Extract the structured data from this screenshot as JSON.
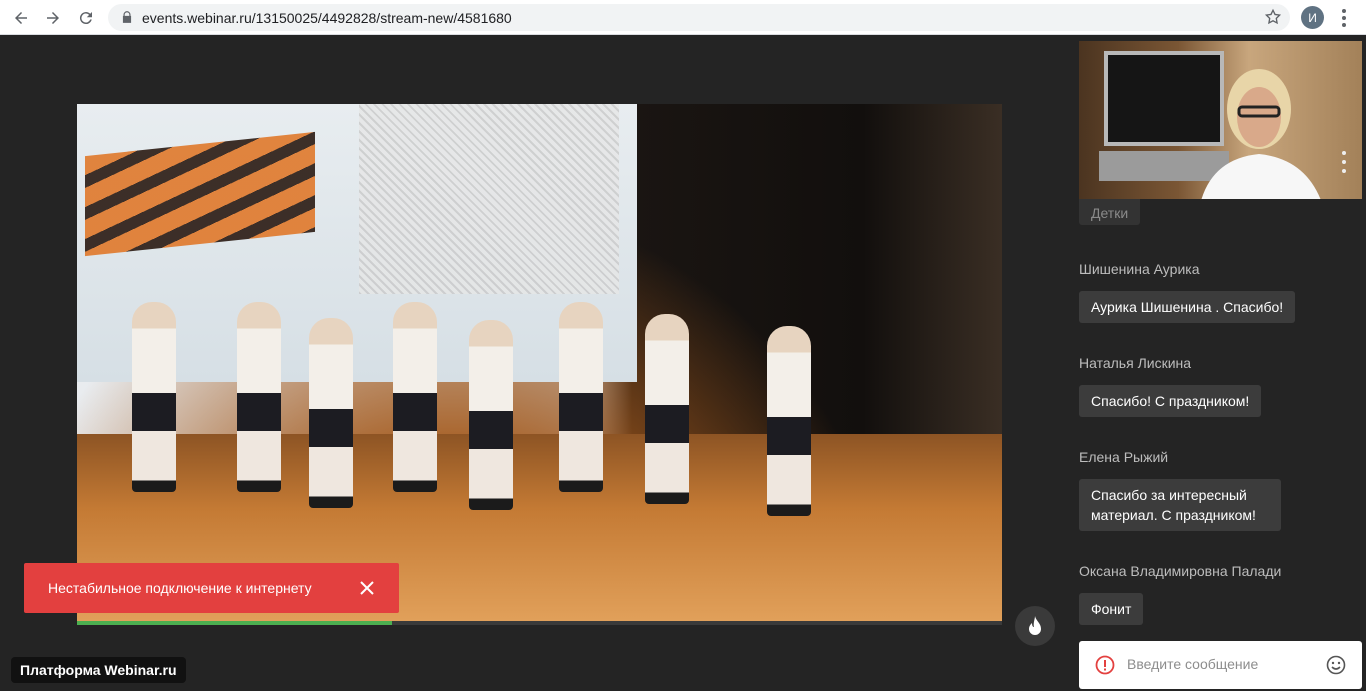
{
  "browser": {
    "url": "events.webinar.ru/13150025/4492828/stream-new/4581680",
    "profile_initial": "И"
  },
  "stage": {
    "progress_fraction": 0.34,
    "toast_message": "Нестабильное подключение к интернету",
    "platform_label": "Платформа Webinar.ru"
  },
  "chat": {
    "messages": [
      {
        "author": "",
        "text": "Детки"
      },
      {
        "author": "Шишенина Аурика",
        "text": "Аурика Шишенина . Спасибо!"
      },
      {
        "author": "Наталья Лискина",
        "text": "Спасибо! С праздником!"
      },
      {
        "author": "Елена Рыжий",
        "text": "Спасибо за интересный материал. С праздником!"
      },
      {
        "author": "Оксана Владимировна Палади",
        "text": "Фонит"
      }
    ],
    "input_placeholder": "Введите сообщение"
  },
  "colors": {
    "background": "#232323",
    "toast": "#e3403f",
    "progress": "#4caf50",
    "bubble": "#3c3c3c"
  },
  "icons": [
    "back-arrow-icon",
    "forward-arrow-icon",
    "reload-icon",
    "lock-icon",
    "star-icon",
    "kebab-menu-icon",
    "close-icon",
    "fire-icon",
    "error-icon",
    "emoji-icon",
    "more-dots-icon"
  ]
}
